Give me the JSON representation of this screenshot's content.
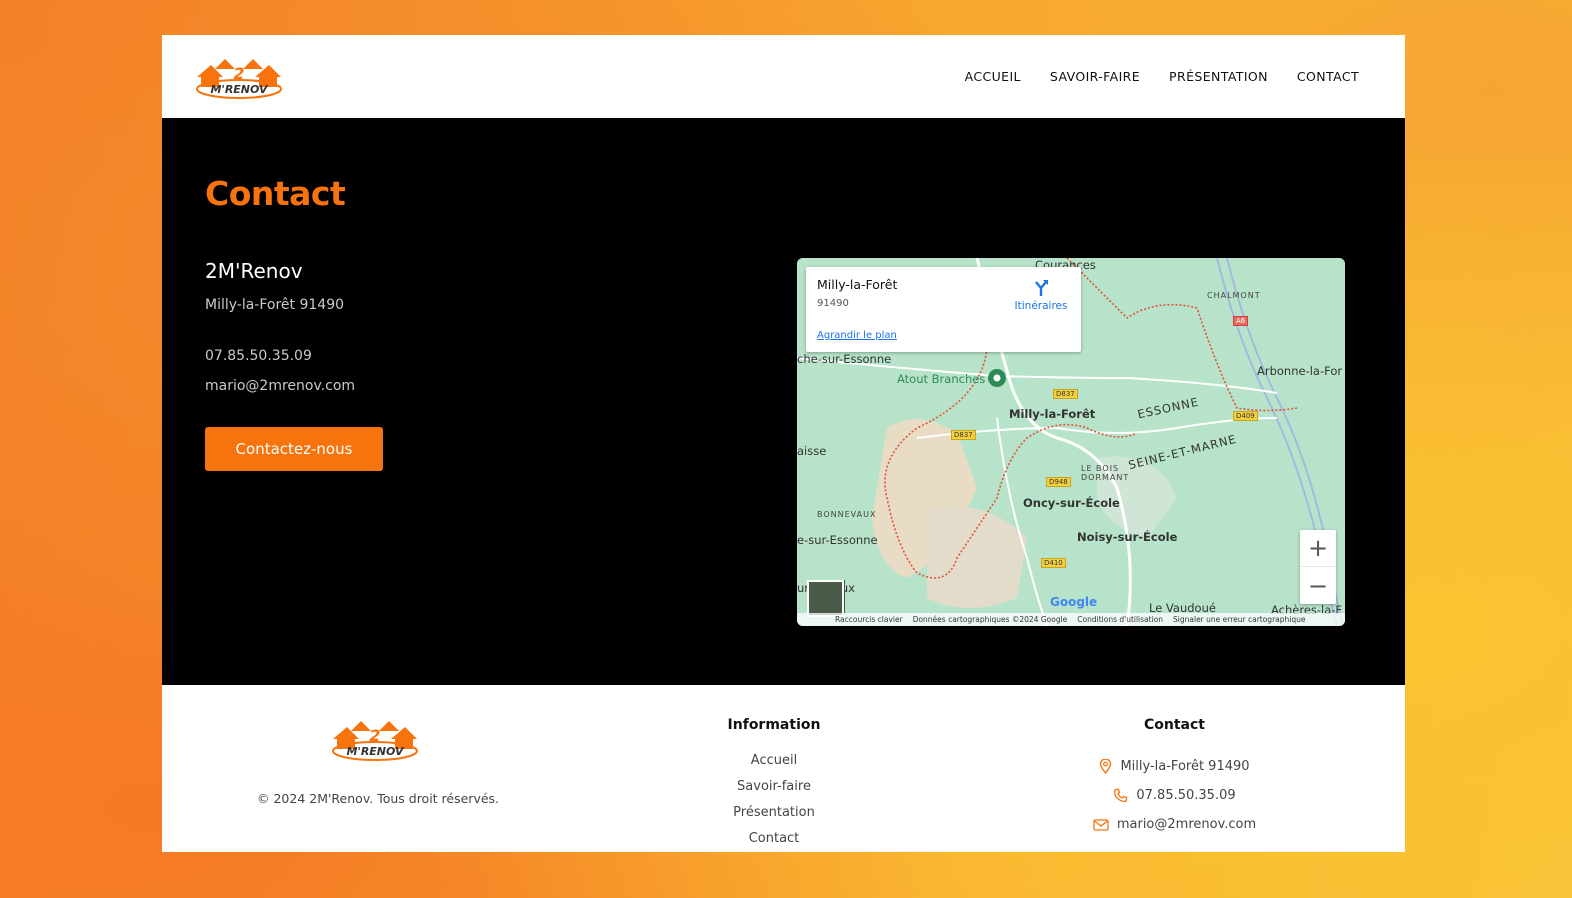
{
  "brand": {
    "logo_text": "2 M'RENOV",
    "accent": "#f7730e"
  },
  "nav": {
    "items": [
      {
        "label": "ACCUEIL"
      },
      {
        "label": "SAVOIR-FAIRE"
      },
      {
        "label": "PRÉSENTATION"
      },
      {
        "label": "CONTACT"
      }
    ]
  },
  "hero": {
    "title": "Contact",
    "company": "2M'Renov",
    "city": "Milly-la-Forêt 91490",
    "phone": "07.85.50.35.09",
    "email": "mario@2mrenov.com",
    "cta_label": "Contactez-nous"
  },
  "map": {
    "popup_title": "Milly-la-Forêt",
    "popup_zip": "91490",
    "popup_link": "Agrandir le plan",
    "directions_label": "Itinéraires",
    "labels": {
      "courances": "Courances",
      "chalmont": "CHALMONT",
      "a6": "A6",
      "esonne_left": "che-sur-Essonne",
      "atout": "Atout Branches",
      "arbonne": "Arbonne-la-For",
      "d837a": "D837",
      "milly": "Milly-la-Forêt",
      "essonne": "ESSONNE",
      "d409": "D409",
      "d837b": "D837",
      "aisse": "aisse",
      "seine": "SEINE-ET-MARNE",
      "lebois": "LE BOIS DORMANT",
      "d948": "D948",
      "oncy": "Oncy-sur-École",
      "bonnevaux": "BONNEVAUX",
      "esonne_left2": "e-sur-Essonne",
      "noisy": "Noisy-sur-École",
      "d410": "D410",
      "nevaux": "ur     nevaux",
      "vaudoue": "Le Vaudoué",
      "acheres": "Achères-la-F"
    },
    "zoom_in": "+",
    "zoom_out": "−",
    "google": "Google",
    "attribution": [
      "Raccourcis clavier",
      "Données cartographiques ©2024 Google",
      "Conditions d'utilisation",
      "Signaler une erreur cartographique"
    ]
  },
  "footer": {
    "copyright": "© 2024 2M'Renov. Tous droit réservés.",
    "info_title": "Information",
    "links": [
      {
        "label": "Accueil"
      },
      {
        "label": "Savoir-faire"
      },
      {
        "label": "Présentation"
      },
      {
        "label": "Contact"
      }
    ],
    "contact_title": "Contact",
    "contact": {
      "city": "Milly-la-Forêt 91490",
      "phone": "07.85.50.35.09",
      "email": "mario@2mrenov.com"
    }
  }
}
